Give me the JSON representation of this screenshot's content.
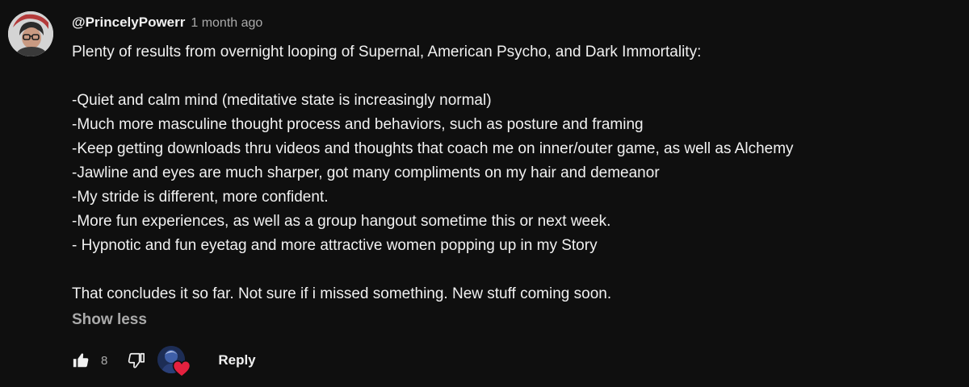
{
  "comment": {
    "author": "@PrincelyPowerr",
    "timestamp": "1 month ago",
    "lines": [
      "Plenty of results from overnight looping of Supernal, American Psycho, and Dark Immortality:",
      "",
      "-Quiet and calm mind (meditative state is increasingly normal)",
      "-Much more masculine thought process and behaviors, such as posture and framing",
      "-Keep getting downloads thru videos and thoughts that coach me on inner/outer game, as well as Alchemy",
      "-Jawline and eyes are much sharper, got many compliments on my hair and demeanor",
      "-My stride is different, more confident.",
      "-More fun experiences, as well as a group hangout sometime this or next week.",
      "- Hypnotic and fun eyetag and more attractive women popping up in my Story",
      "",
      "That concludes it so far. Not sure if i missed something. New stuff coming soon."
    ],
    "show_less_label": "Show less"
  },
  "toolbar": {
    "like_icon": "thumbs-up-icon",
    "like_count": "8",
    "dislike_icon": "thumbs-down-icon",
    "creator_heart_icon": "heart-icon",
    "reply_label": "Reply"
  },
  "colors": {
    "background": "#0f0f0f",
    "text_primary": "#f1f1f1",
    "text_secondary": "#aaaaaa",
    "heart": "#e5213f"
  }
}
